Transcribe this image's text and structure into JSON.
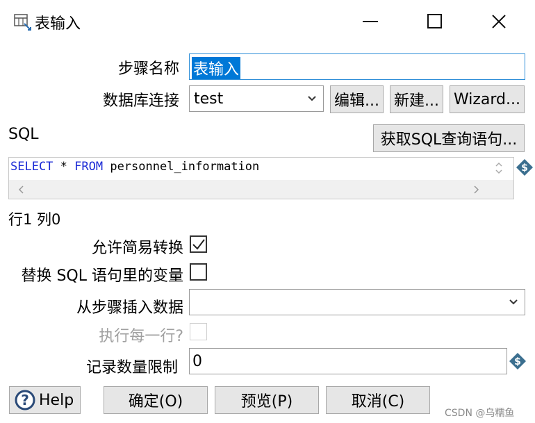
{
  "window": {
    "title": "表输入",
    "minimize": "—",
    "maximize": "☐",
    "close": "✕"
  },
  "form": {
    "step_name_label": "步骤名称",
    "step_name_value": "表输入",
    "connection_label": "数据库连接",
    "connection_value": "test",
    "edit_button": "编辑...",
    "new_button": "新建...",
    "wizard_button": "Wizard...",
    "sql_label": "SQL",
    "get_sql_button": "获取SQL查询语句...",
    "sql": {
      "kw1": "SELECT",
      "mid": " * ",
      "kw2": "FROM",
      "rest": " personnel_information"
    },
    "position_text": "行1 列0",
    "lazy_conversion_label": "允许简易转换",
    "lazy_conversion_checked": true,
    "replace_vars_label": "替换 SQL 语句里的变量",
    "replace_vars_checked": false,
    "insert_from_step_label": "从步骤插入数据",
    "insert_from_step_value": "",
    "execute_each_row_label": "执行每一行?",
    "execute_each_row_checked": false,
    "limit_label": "记录数量限制",
    "limit_value": "0"
  },
  "buttons": {
    "help": "Help",
    "ok": "确定(O)",
    "preview": "预览(P)",
    "cancel": "取消(C)"
  },
  "watermark": "CSDN @乌糯鱼",
  "colors": {
    "sql_keyword": "#1c2bd6",
    "selection": "#0078d7",
    "variable_icon": "#3b6f8f"
  }
}
